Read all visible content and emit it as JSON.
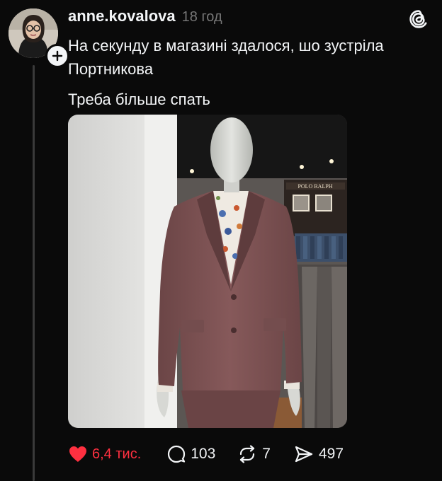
{
  "post": {
    "username": "anne.kovalova",
    "timestamp": "18 год",
    "text_lines": [
      "На секунду в магазині здалося, шо зустріла Портникова",
      "Треба більше спать"
    ]
  },
  "photo": {
    "store_sign": "POLO RALPH"
  },
  "actions": {
    "like_count": "6,4 тис.",
    "reply_count": "103",
    "repost_count": "7",
    "share_count": "497"
  },
  "icons": {
    "avatar": "avatar",
    "follow": "plus-icon",
    "logo": "threads-logo-icon",
    "like": "heart-icon",
    "reply": "comment-icon",
    "repost": "repost-icon",
    "share": "send-icon"
  },
  "colors": {
    "background": "#0a0a0a",
    "text": "#f3f5f7",
    "muted": "#777777",
    "like": "#ff3040"
  }
}
